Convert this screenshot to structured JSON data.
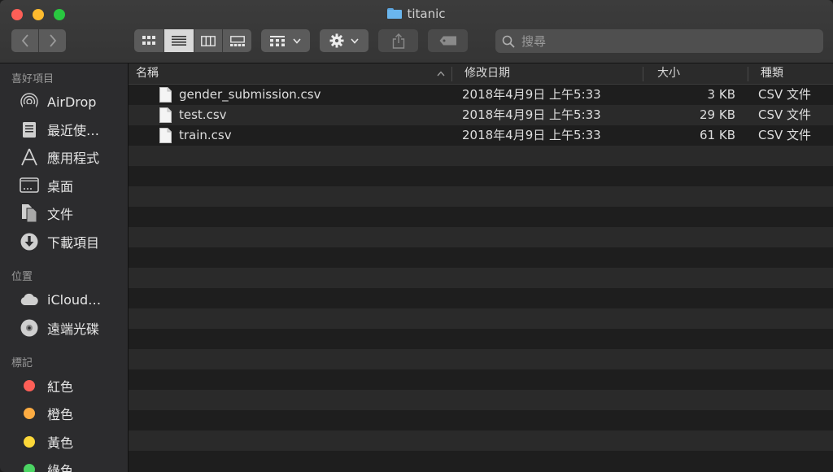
{
  "window": {
    "title": "titanic",
    "folder_icon": "folder-icon"
  },
  "toolbar": {
    "back_icon": "chevron-left-icon",
    "forward_icon": "chevron-right-icon",
    "view_modes": [
      "icon-grid-icon",
      "list-view-icon",
      "column-view-icon",
      "gallery-view-icon"
    ],
    "active_view": "list-view-icon",
    "group_icon": "group-grid-icon",
    "action_icon": "gear-icon",
    "share_icon": "share-icon",
    "tag_icon": "tag-icon",
    "search_placeholder": "搜尋"
  },
  "sidebar": {
    "favorites_label": "喜好項目",
    "favorites": [
      {
        "label": "AirDrop",
        "icon": "airdrop-icon"
      },
      {
        "label": "最近使…",
        "icon": "recents-icon"
      },
      {
        "label": "應用程式",
        "icon": "applications-icon"
      },
      {
        "label": "桌面",
        "icon": "desktop-icon"
      },
      {
        "label": "文件",
        "icon": "documents-icon"
      },
      {
        "label": "下載項目",
        "icon": "downloads-icon"
      }
    ],
    "locations_label": "位置",
    "locations": [
      {
        "label": "iCloud…",
        "icon": "icloud-icon"
      },
      {
        "label": "遠端光碟",
        "icon": "remote-disc-icon"
      }
    ],
    "tags_label": "標記",
    "tags": [
      {
        "label": "紅色",
        "color": "#fe5f57"
      },
      {
        "label": "橙色",
        "color": "#fdac42"
      },
      {
        "label": "黃色",
        "color": "#fdd839"
      },
      {
        "label": "綠色",
        "color": "#4bd463"
      }
    ]
  },
  "columns": {
    "name": "名稱",
    "date": "修改日期",
    "size": "大小",
    "kind": "種類",
    "sort_indicator": "sort-ascending-icon"
  },
  "files": [
    {
      "name": "gender_submission.csv",
      "date": "2018年4月9日 上午5:33",
      "size": "3 KB",
      "kind": "CSV 文件"
    },
    {
      "name": "test.csv",
      "date": "2018年4月9日 上午5:33",
      "size": "29 KB",
      "kind": "CSV 文件"
    },
    {
      "name": "train.csv",
      "date": "2018年4月9日 上午5:33",
      "size": "61 KB",
      "kind": "CSV 文件"
    }
  ]
}
